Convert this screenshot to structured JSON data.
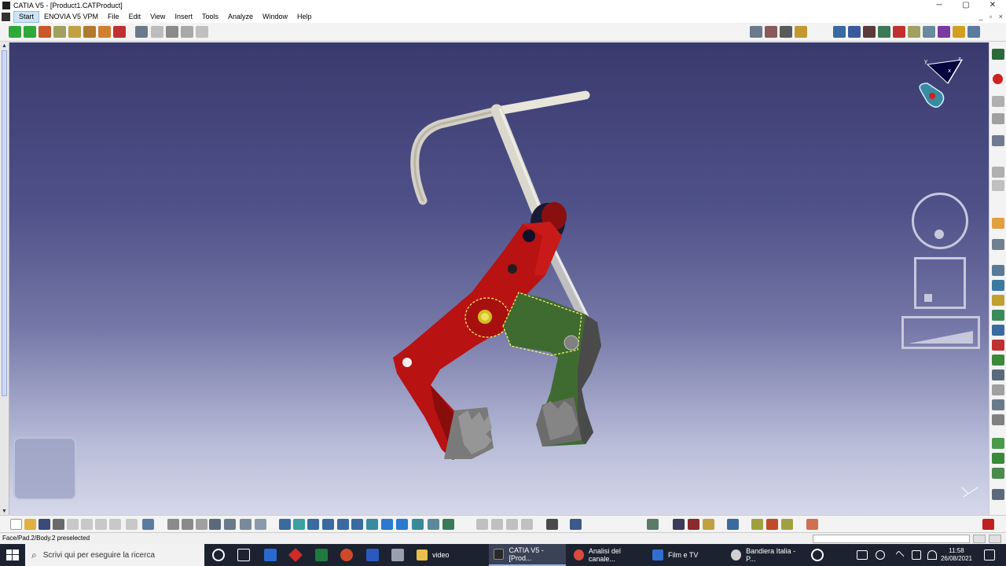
{
  "window": {
    "title": "CATIA V5 - [Product1.CATProduct]",
    "controls": {
      "minimize": "─",
      "maximize": "▢",
      "close": "✕"
    }
  },
  "menu": {
    "items": [
      "Start",
      "ENOVIA V5 VPM",
      "File",
      "Edit",
      "View",
      "Insert",
      "Tools",
      "Analyze",
      "Window",
      "Help"
    ],
    "doc_controls": {
      "minimize": "_",
      "restore": "▫",
      "close": "×"
    }
  },
  "compass": {
    "axis_x": "x",
    "axis_y": "y",
    "axis_z": "z"
  },
  "status_bar": {
    "message": "Face/Pad.2/Body.2 preselected"
  },
  "colors": {
    "viewport_top": "#3a3a6e",
    "viewport_bottom": "#d6d8ea",
    "part_red": "#b81212",
    "part_green": "#3f6b30",
    "handle_grey": "#d4d0c4",
    "jaw_grey": "#808080"
  },
  "taskbar": {
    "search_placeholder": "Scrivi qui per eseguire la ricerca",
    "apps": [
      {
        "label": "video",
        "icon": "folder-icon",
        "color": "#e8c04a"
      },
      {
        "label": "CATIA V5 - [Prod...",
        "icon": "catia-icon",
        "color": "#2a2a2a"
      },
      {
        "label": "Analisi del canale...",
        "icon": "chrome-icon",
        "color": "#dc4a3c"
      },
      {
        "label": "Film e TV",
        "icon": "film-icon",
        "color": "#2f6fd0"
      },
      {
        "label": "Bandiera Italia - P...",
        "icon": "paint-icon",
        "color": "#d0d0d0"
      }
    ],
    "clock": {
      "time": "11:58",
      "date": "26/08/2021"
    }
  }
}
